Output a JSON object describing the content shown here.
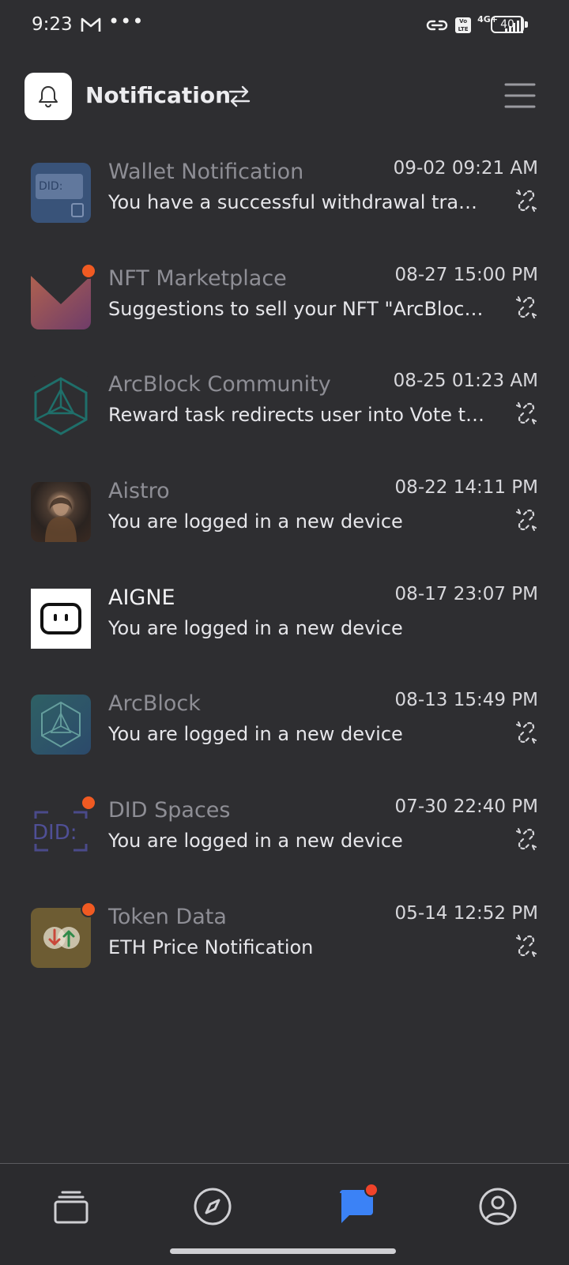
{
  "status": {
    "time": "9:23",
    "battery": "40",
    "network": "4G+",
    "volte": "Vo LTE"
  },
  "header": {
    "title": "Notification"
  },
  "notifications": [
    {
      "title": "Wallet Notification",
      "time": "09-02 09:21 AM",
      "message": "You have a successful withdrawal trans...",
      "unread": false,
      "title_bright": false,
      "avatar": "wallet-did-icon"
    },
    {
      "title": "NFT Marketplace",
      "time": "08-27 15:00 PM",
      "message": "Suggestions to sell your NFT \"ArcBlock...",
      "unread": true,
      "title_bright": false,
      "avatar": "nft-marketplace-logo"
    },
    {
      "title": "ArcBlock Community",
      "time": "08-25 01:23 AM",
      "message": "Reward task redirects user into Vote tab...",
      "unread": false,
      "title_bright": false,
      "avatar": "arcblock-community-logo"
    },
    {
      "title": "Aistro",
      "time": "08-22 14:11 PM",
      "message": "You are logged in a new device",
      "unread": false,
      "title_bright": false,
      "avatar": "aistro-portrait"
    },
    {
      "title": "AIGNE",
      "time": "08-17 23:07 PM",
      "message": "You are logged in a new device",
      "unread": false,
      "title_bright": true,
      "avatar": "aigne-logo"
    },
    {
      "title": "ArcBlock",
      "time": "08-13 15:49 PM",
      "message": "You are logged in a new device",
      "unread": false,
      "title_bright": false,
      "avatar": "arcblock-logo"
    },
    {
      "title": "DID Spaces",
      "time": "07-30 22:40 PM",
      "message": "You are logged in a new device",
      "unread": true,
      "title_bright": false,
      "avatar": "did-spaces-logo"
    },
    {
      "title": "Token Data",
      "time": "05-14 12:52 PM",
      "message": "ETH Price Notification",
      "unread": true,
      "title_bright": false,
      "avatar": "token-data-logo"
    }
  ],
  "colors": {
    "background": "#2e2e31",
    "unread_dot": "#f05a22",
    "accent": "#3b82f6"
  },
  "nav": {
    "items": [
      "cards-icon",
      "compass-icon",
      "chat-icon",
      "profile-icon"
    ],
    "active": "chat-icon"
  }
}
